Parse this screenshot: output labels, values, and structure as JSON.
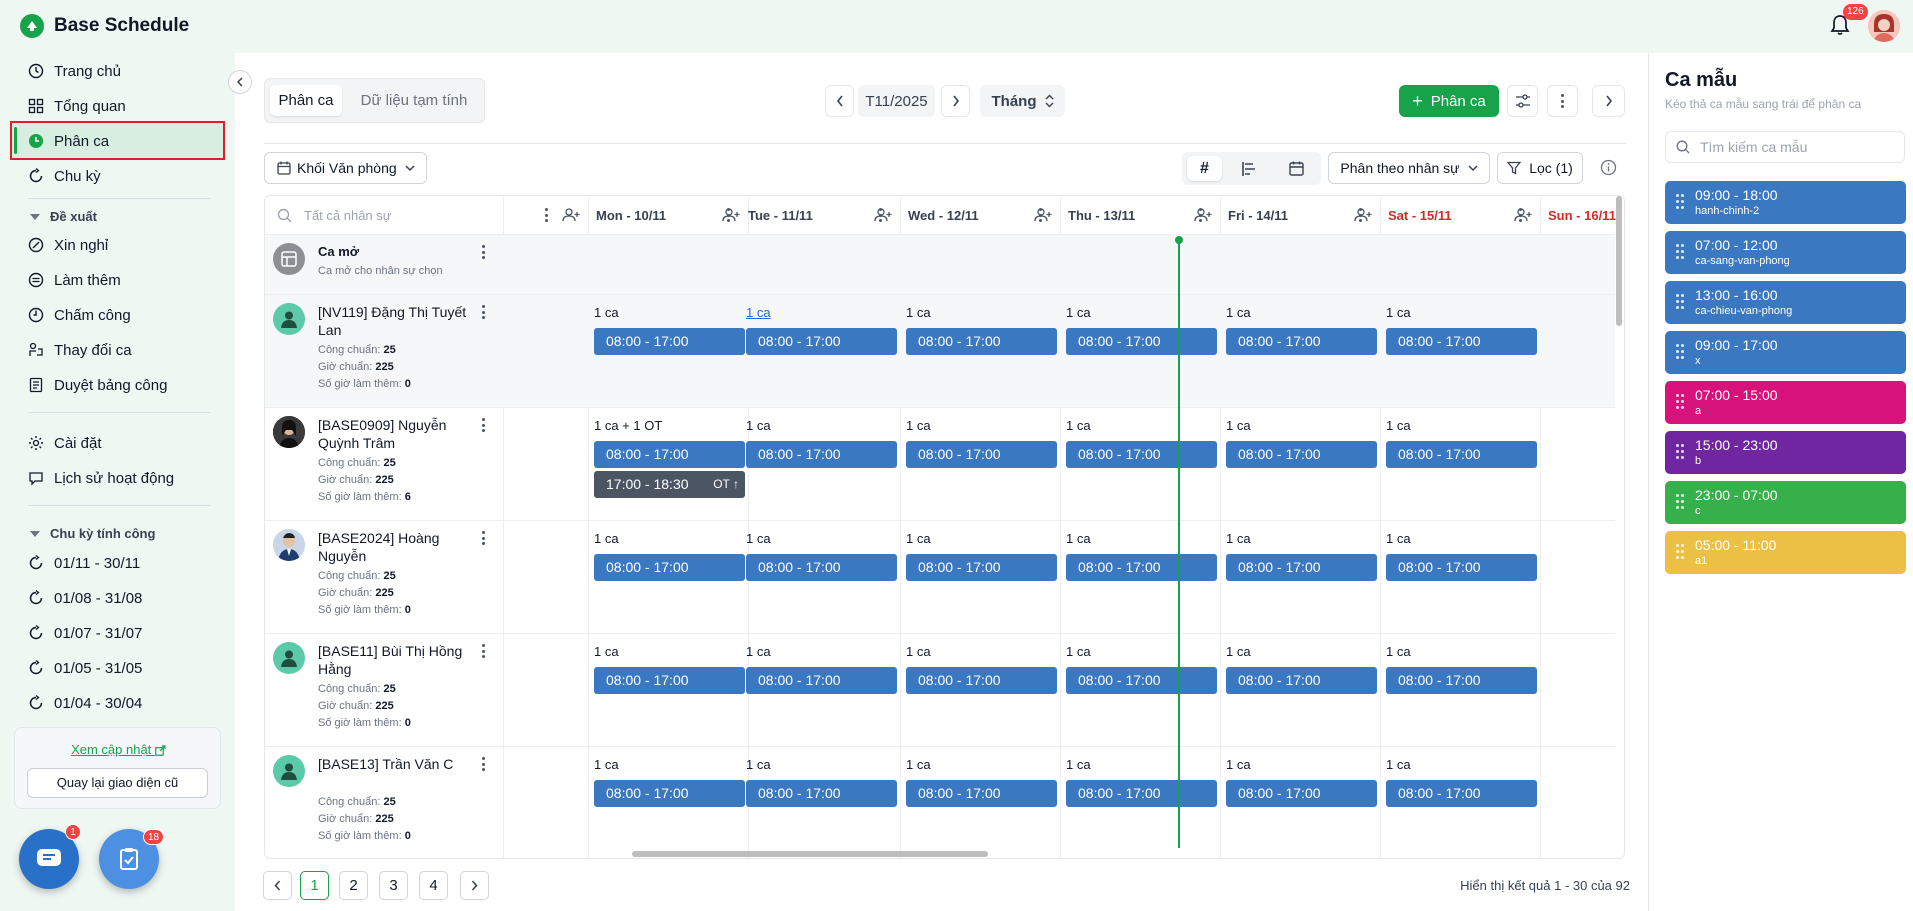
{
  "app": {
    "title": "Base Schedule",
    "notif_count": "126"
  },
  "sidebar": {
    "nav": [
      {
        "label": "Trang chủ",
        "icon": "clock-icon"
      },
      {
        "label": "Tổng quan",
        "icon": "grid-icon"
      },
      {
        "label": "Phân ca",
        "icon": "shift-icon"
      },
      {
        "label": "Chu kỳ",
        "icon": "cycle-icon"
      }
    ],
    "proposal_title": "Đề xuất",
    "proposal_items": [
      {
        "label": "Xin nghỉ",
        "icon": "leave-icon"
      },
      {
        "label": "Làm thêm",
        "icon": "overtime-icon"
      },
      {
        "label": "Chấm công",
        "icon": "timekeeping-icon"
      },
      {
        "label": "Thay đổi ca",
        "icon": "swap-icon"
      },
      {
        "label": "Duyệt bảng công",
        "icon": "timesheet-icon"
      }
    ],
    "settings": [
      {
        "label": "Cài đặt",
        "icon": "gear-icon"
      },
      {
        "label": "Lịch sử hoạt động",
        "icon": "history-icon"
      }
    ],
    "cycle_title": "Chu kỳ tính công",
    "cycles": [
      "01/11 - 30/11",
      "01/08 - 31/08",
      "01/07 - 31/07",
      "01/05 - 31/05",
      "01/04 - 30/04"
    ],
    "update_link": "Xem cập nhật",
    "old_ui_button": "Quay lại giao diện cũ",
    "chat_badge": "1",
    "task_badge": "18"
  },
  "toolbar": {
    "tabs": [
      "Phân ca",
      "Dữ liệu tạm tính"
    ],
    "period": "T11/2025",
    "view_mode": "Tháng",
    "assign_button": "Phân ca",
    "department": "Khối Văn phòng",
    "group_by": "Phân theo nhân sự",
    "filter": "Lọc (1)"
  },
  "grid": {
    "search_placeholder": "Tất cả nhân sự",
    "days": [
      {
        "label": "Mon - 10/11",
        "weekend": false
      },
      {
        "label": "Tue - 11/11",
        "weekend": false
      },
      {
        "label": "Wed - 12/11",
        "weekend": false
      },
      {
        "label": "Thu - 13/11",
        "weekend": false
      },
      {
        "label": "Fri - 14/11",
        "weekend": false
      },
      {
        "label": "Sat - 15/11",
        "weekend": true
      },
      {
        "label": "Sun - 16/11",
        "weekend": true
      }
    ],
    "open_shift": {
      "title": "Ca mở",
      "subtitle": "Ca mở cho nhân sự chọn"
    },
    "meta_labels": {
      "standard_days": "Công chuẩn:",
      "standard_hours": "Giờ chuẩn:",
      "ot_hours": "Số giờ làm thêm:"
    },
    "employees": [
      {
        "name": "[NV119] Đặng Thị Tuyết Lan",
        "avatar": "default",
        "standard_days": "25",
        "standard_hours": "225",
        "ot_hours": "0",
        "days": [
          {
            "count": "1 ca",
            "link": false,
            "shifts": [
              "08:00 - 17:00"
            ]
          },
          {
            "count": "1 ca",
            "link": true,
            "shifts": [
              "08:00 - 17:00"
            ]
          },
          {
            "count": "1 ca",
            "link": false,
            "shifts": [
              "08:00 - 17:00"
            ]
          },
          {
            "count": "1 ca",
            "link": false,
            "shifts": [
              "08:00 - 17:00"
            ]
          },
          {
            "count": "1 ca",
            "link": false,
            "shifts": [
              "08:00 - 17:00"
            ]
          },
          {
            "count": "1 ca",
            "link": false,
            "shifts": [
              "08:00 - 17:00"
            ]
          }
        ]
      },
      {
        "name": "[BASE0909] Nguyễn Quỳnh Trâm",
        "avatar": "photo-dark",
        "standard_days": "25",
        "standard_hours": "225",
        "ot_hours": "6",
        "days": [
          {
            "count": "1 ca + 1 OT",
            "link": false,
            "shifts": [
              "08:00 - 17:00"
            ],
            "ot": {
              "time": "17:00 - 18:30",
              "tag": "OT"
            }
          },
          {
            "count": "1 ca",
            "link": false,
            "shifts": [
              "08:00 - 17:00"
            ]
          },
          {
            "count": "1 ca",
            "link": false,
            "shifts": [
              "08:00 - 17:00"
            ]
          },
          {
            "count": "1 ca",
            "link": false,
            "shifts": [
              "08:00 - 17:00"
            ]
          },
          {
            "count": "1 ca",
            "link": false,
            "shifts": [
              "08:00 - 17:00"
            ]
          },
          {
            "count": "1 ca",
            "link": false,
            "shifts": [
              "08:00 - 17:00"
            ]
          }
        ]
      },
      {
        "name": "[BASE2024] Hoàng Nguyễn",
        "avatar": "photo-suit",
        "standard_days": "25",
        "standard_hours": "225",
        "ot_hours": "0",
        "days": [
          {
            "count": "1 ca",
            "link": false,
            "shifts": [
              "08:00 - 17:00"
            ]
          },
          {
            "count": "1 ca",
            "link": false,
            "shifts": [
              "08:00 - 17:00"
            ]
          },
          {
            "count": "1 ca",
            "link": false,
            "shifts": [
              "08:00 - 17:00"
            ]
          },
          {
            "count": "1 ca",
            "link": false,
            "shifts": [
              "08:00 - 17:00"
            ]
          },
          {
            "count": "1 ca",
            "link": false,
            "shifts": [
              "08:00 - 17:00"
            ]
          },
          {
            "count": "1 ca",
            "link": false,
            "shifts": [
              "08:00 - 17:00"
            ]
          }
        ]
      },
      {
        "name": "[BASE11] Bùi Thị Hồng Hằng",
        "avatar": "default",
        "standard_days": "25",
        "standard_hours": "225",
        "ot_hours": "0",
        "days": [
          {
            "count": "1 ca",
            "link": false,
            "shifts": [
              "08:00 - 17:00"
            ]
          },
          {
            "count": "1 ca",
            "link": false,
            "shifts": [
              "08:00 - 17:00"
            ]
          },
          {
            "count": "1 ca",
            "link": false,
            "shifts": [
              "08:00 - 17:00"
            ]
          },
          {
            "count": "1 ca",
            "link": false,
            "shifts": [
              "08:00 - 17:00"
            ]
          },
          {
            "count": "1 ca",
            "link": false,
            "shifts": [
              "08:00 - 17:00"
            ]
          },
          {
            "count": "1 ca",
            "link": false,
            "shifts": [
              "08:00 - 17:00"
            ]
          }
        ]
      },
      {
        "name": "[BASE13] Trần Văn C",
        "avatar": "default",
        "standard_days": "25",
        "standard_hours": "225",
        "ot_hours": "0",
        "days": [
          {
            "count": "1 ca",
            "link": false,
            "shifts": [
              "08:00 - 17:00"
            ]
          },
          {
            "count": "1 ca",
            "link": false,
            "shifts": [
              "08:00 - 17:00"
            ]
          },
          {
            "count": "1 ca",
            "link": false,
            "shifts": [
              "08:00 - 17:00"
            ]
          },
          {
            "count": "1 ca",
            "link": false,
            "shifts": [
              "08:00 - 17:00"
            ]
          },
          {
            "count": "1 ca",
            "link": false,
            "shifts": [
              "08:00 - 17:00"
            ]
          },
          {
            "count": "1 ca",
            "link": false,
            "shifts": [
              "08:00 - 17:00"
            ]
          }
        ]
      }
    ]
  },
  "pagination": {
    "pages": [
      "1",
      "2",
      "3",
      "4"
    ],
    "current": "1",
    "summary": "Hiển thị kết quả 1 - 30 của 92"
  },
  "templates_panel": {
    "title": "Ca mẫu",
    "subtitle": "Kéo thả ca mẫu sang trái để phân ca",
    "search_placeholder": "Tìm kiếm ca mẫu",
    "items": [
      {
        "time": "09:00 - 18:00",
        "code": "hanh-chinh-2",
        "color": "#3b78c2"
      },
      {
        "time": "07:00 - 12:00",
        "code": "ca-sang-van-phong",
        "color": "#3b78c2"
      },
      {
        "time": "13:00 - 16:00",
        "code": "ca-chieu-van-phong",
        "color": "#3b78c2"
      },
      {
        "time": "09:00 - 17:00",
        "code": "x",
        "color": "#3b78c2"
      },
      {
        "time": "07:00 - 15:00",
        "code": "a",
        "color": "#d8127b"
      },
      {
        "time": "15:00 - 23:00",
        "code": "b",
        "color": "#7026a0"
      },
      {
        "time": "23:00 - 07:00",
        "code": "c",
        "color": "#36b04a"
      },
      {
        "time": "05:00 - 11:00",
        "code": "a1",
        "color": "#ecc044"
      }
    ]
  }
}
